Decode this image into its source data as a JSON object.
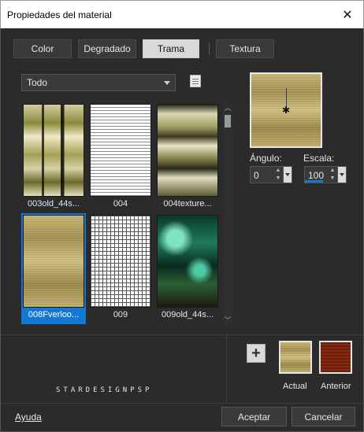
{
  "window": {
    "title": "Propiedades del material",
    "close_glyph": "✕"
  },
  "tabs": [
    {
      "label": "Color"
    },
    {
      "label": "Degradado"
    },
    {
      "label": "Trama",
      "selected": true
    },
    {
      "label": "Textura"
    }
  ],
  "category": {
    "selected": "Todo"
  },
  "patterns": [
    {
      "name": "003old_44s...",
      "swatch": "olive-green-photo-strips"
    },
    {
      "name": "004",
      "swatch": "white-grey-horizontal-lines"
    },
    {
      "name": "004texture...",
      "swatch": "pale-olive-texture"
    },
    {
      "name": "008Fverloo...",
      "swatch": "gold-metallic",
      "selected": true
    },
    {
      "name": "009",
      "swatch": "black-white-grid"
    },
    {
      "name": "009old_44s...",
      "swatch": "teal-green-photo"
    }
  ],
  "angle": {
    "label": "Ángulo:",
    "value": "0"
  },
  "scale": {
    "label": "Escala:",
    "value": "100",
    "level_percent": 45
  },
  "watermark": "STARDESIGNPSP",
  "add_button": {
    "glyph": "+"
  },
  "swatches": {
    "actual_label": "Actual",
    "anterior_label": "Anterior"
  },
  "footer": {
    "help": "Ayuda",
    "ok": "Aceptar",
    "cancel": "Cancelar"
  },
  "colors": {
    "selection": "#1377d4",
    "background": "#2b2b2b"
  }
}
